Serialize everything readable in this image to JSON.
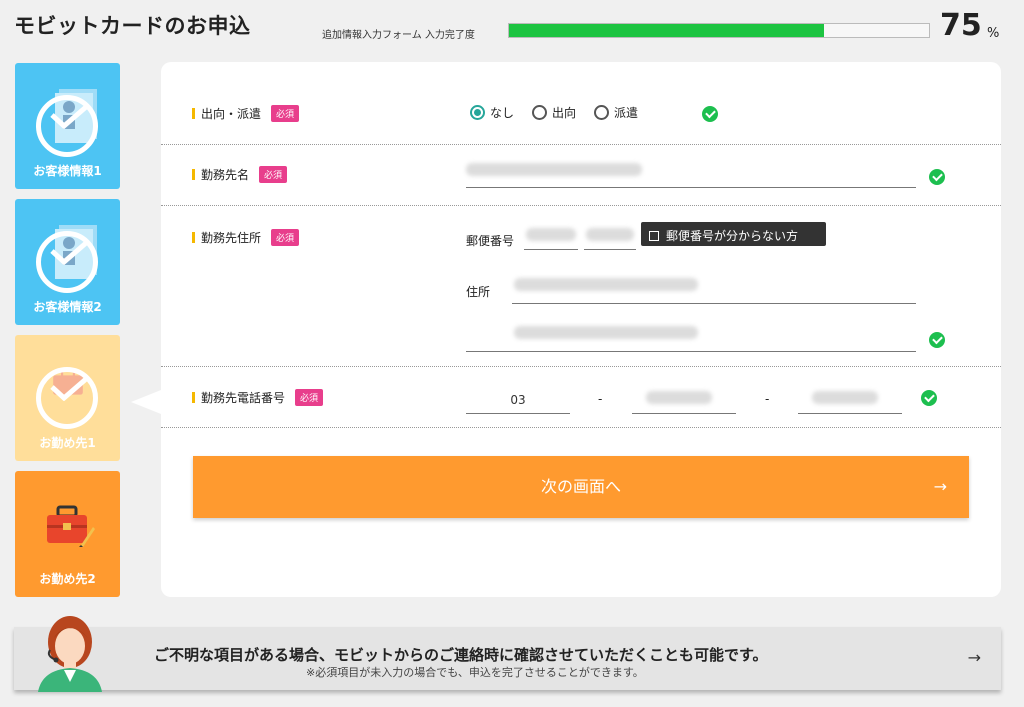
{
  "header": {
    "title": "モビットカードのお申込",
    "progress_label": "追加情報入力フォーム 入力完了度",
    "progress_value": 75,
    "progress_number": "75",
    "progress_unit": "%"
  },
  "steps": [
    {
      "label": "お客様情報1",
      "state": "done",
      "color": "#4dc4f3"
    },
    {
      "label": "お客様情報2",
      "state": "done",
      "color": "#4dc4f3"
    },
    {
      "label": "お勤め先1",
      "state": "current",
      "color": "#ffde9a"
    },
    {
      "label": "お勤め先2",
      "state": "upcoming",
      "color": "#ff9a2f"
    }
  ],
  "form": {
    "required_badge": "必須",
    "secondment": {
      "label": "出向・派遣",
      "options": [
        "なし",
        "出向",
        "派遣"
      ],
      "selected": "なし"
    },
    "employer_name": {
      "label": "勤務先名"
    },
    "employer_address": {
      "label": "勤務先住所",
      "postal_label": "郵便番号",
      "postal_help": "郵便番号が分からない方",
      "address_label": "住所"
    },
    "employer_phone": {
      "label": "勤務先電話番号",
      "part1": "03",
      "separator": "-"
    },
    "next_button": "次の画面へ",
    "arrow": "→"
  },
  "help": {
    "main": "ご不明な項目がある場合、モビットからのご連絡時に確認させていただくことも可能です。",
    "sub": "※必須項目が未入力の場合でも、申込を完了させることができます。",
    "arrow": "→"
  },
  "colors": {
    "progress": "#1dc441",
    "accent_orange": "#ff9a2f",
    "badge": "#e83e8c",
    "ok_green": "#1dbf4f"
  }
}
